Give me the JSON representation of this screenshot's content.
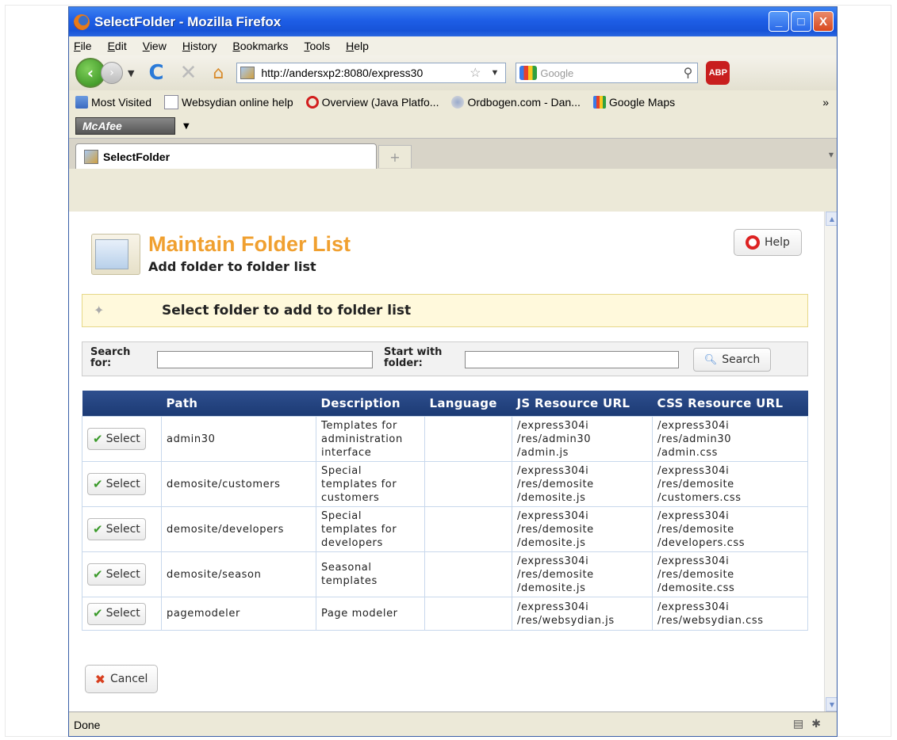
{
  "window": {
    "title": "SelectFolder - Mozilla Firefox",
    "controls": {
      "minimize": "_",
      "maximize": "□",
      "close": "X"
    }
  },
  "menu": [
    "File",
    "Edit",
    "View",
    "History",
    "Bookmarks",
    "Tools",
    "Help"
  ],
  "nav": {
    "url": "http://andersxp2:8080/express30",
    "search_placeholder": "Google",
    "abp_label": "ABP"
  },
  "bookmarks": [
    {
      "label": "Most Visited",
      "icon": "most-visited-icon"
    },
    {
      "label": "Websydian online help",
      "icon": "page-icon"
    },
    {
      "label": "Overview (Java Platfo...",
      "icon": "oracle-icon"
    },
    {
      "label": "Ordbogen.com - Dan...",
      "icon": "ordbogen-icon"
    },
    {
      "label": "Google Maps",
      "icon": "google-icon"
    }
  ],
  "bookmarks_overflow": "»",
  "mcafee": {
    "label": "McAfee",
    "dropdown": "▼"
  },
  "tab": {
    "label": "SelectFolder",
    "new_tab": "+"
  },
  "page": {
    "title": "Maintain Folder List",
    "subtitle": "Add folder to folder list",
    "help_label": "Help",
    "notice": "Select folder to add to folder list",
    "search": {
      "search_for_label": "Search for:",
      "start_with_label": "Start with folder:",
      "search_for_value": "",
      "start_with_value": "",
      "button_label": "Search"
    },
    "table": {
      "columns": [
        "",
        "Path",
        "Description",
        "Language",
        "JS Resource URL",
        "CSS Resource URL"
      ],
      "select_label": "Select",
      "rows": [
        {
          "path": "admin30",
          "description": "Templates for\nadministration\ninterface",
          "language": "",
          "js": "/express304i\n/res/admin30\n/admin.js",
          "css": "/express304i\n/res/admin30\n/admin.css"
        },
        {
          "path": "demosite/customers",
          "description": "Special\ntemplates for\ncustomers",
          "language": "",
          "js": "/express304i\n/res/demosite\n/demosite.js",
          "css": "/express304i\n/res/demosite\n/customers.css"
        },
        {
          "path": "demosite/developers",
          "description": "Special\ntemplates for\ndevelopers",
          "language": "",
          "js": "/express304i\n/res/demosite\n/demosite.js",
          "css": "/express304i\n/res/demosite\n/developers.css"
        },
        {
          "path": "demosite/season",
          "description": "Seasonal\ntemplates",
          "language": "",
          "js": "/express304i\n/res/demosite\n/demosite.js",
          "css": "/express304i\n/res/demosite\n/demosite.css"
        },
        {
          "path": "pagemodeler",
          "description": "Page modeler",
          "language": "",
          "js": "/express304i\n/res/websydian.js",
          "css": "/express304i\n/res/websydian.css"
        }
      ]
    },
    "cancel_label": "Cancel"
  },
  "status": {
    "text": "Done"
  },
  "colors": {
    "title_orange": "#f0a030",
    "table_header": "#1f3e78",
    "notice_bg": "#fff9dc"
  }
}
